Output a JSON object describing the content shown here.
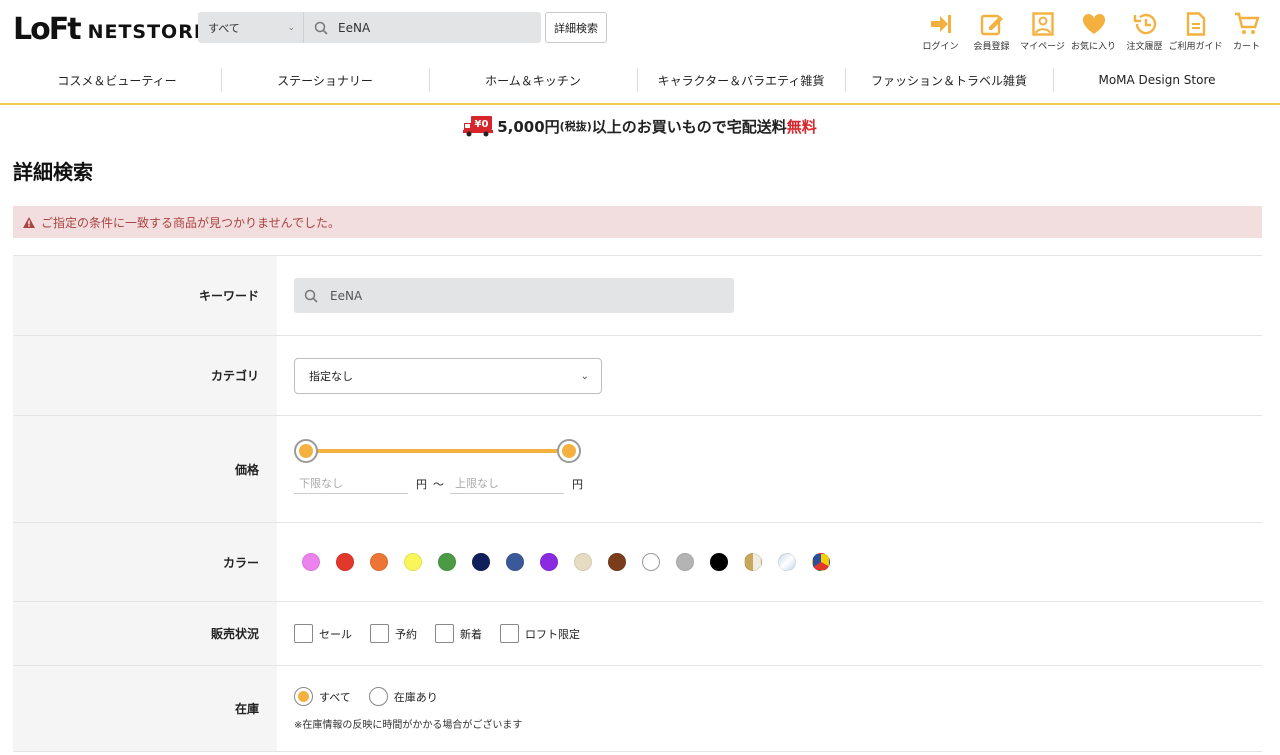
{
  "header": {
    "logo_loft": "LoFt",
    "logo_netstore": "NETSTORE",
    "search": {
      "scope": "すべて",
      "value": "EeNA"
    },
    "advanced_search_label": "詳細検索",
    "utility": [
      {
        "label": "ログイン",
        "icon": "login-icon"
      },
      {
        "label": "会員登録",
        "icon": "register-icon"
      },
      {
        "label": "マイページ",
        "icon": "mypage-icon"
      },
      {
        "label": "お気に入り",
        "icon": "heart-icon"
      },
      {
        "label": "注文履歴",
        "icon": "history-icon"
      },
      {
        "label": "ご利用ガイド",
        "icon": "guide-icon"
      },
      {
        "label": "カート",
        "icon": "cart-icon"
      }
    ]
  },
  "categories": [
    "コスメ＆ビューティー",
    "ステーショナリー",
    "ホーム＆キッチン",
    "キャラクター＆バラエティ雑貨",
    "ファッション＆トラベル雑貨",
    "MoMA Design Store"
  ],
  "banner": {
    "truck_badge": "¥0",
    "amount": "5,000円",
    "tax": "(税抜)",
    "text": "以上のお買いもので宅配送料",
    "free": "無料"
  },
  "page": {
    "title": "詳細検索",
    "alert": "ご指定の条件に一致する商品が見つかりませんでした。"
  },
  "form": {
    "keyword": {
      "label": "キーワード",
      "value": "EeNA"
    },
    "category": {
      "label": "カテゴリ",
      "value": "指定なし"
    },
    "price": {
      "label": "価格",
      "min_placeholder": "下限なし",
      "max_placeholder": "上限なし",
      "unit": "円",
      "separator": "〜",
      "slider_min_fraction": 0,
      "slider_max_fraction": 1
    },
    "color": {
      "label": "カラー",
      "swatches": [
        "#ec82ec",
        "#e2372b",
        "#ec7434",
        "#f8f65a",
        "#4b9b44",
        "#0f1f5a",
        "#3b5998",
        "#8a2be2",
        "#e6dcc4",
        "#7a3d1c",
        "#ffffff",
        "#b4b4b4",
        "#000000",
        "gold-half",
        "silver-half",
        "multi"
      ]
    },
    "status": {
      "label": "販売状況",
      "options": [
        "セール",
        "予約",
        "新着",
        "ロフト限定"
      ]
    },
    "stock": {
      "label": "在庫",
      "options": [
        "すべて",
        "在庫あり"
      ],
      "selected": "すべて",
      "note": "※在庫情報の反映に時間がかかる場合がございます"
    }
  },
  "colors": {
    "accent": "#f4b13f",
    "nav_line": "#f3c94a",
    "alert_bg": "#f3dedf",
    "alert_text": "#a94442",
    "free_red": "#d6262c"
  }
}
